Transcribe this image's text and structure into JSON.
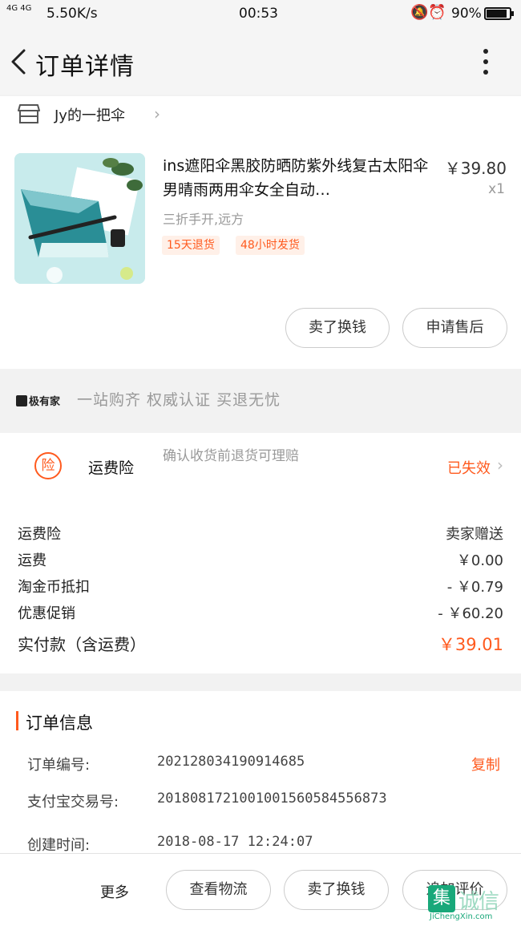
{
  "status_bar": {
    "signal": "4G 4G",
    "speed": "5.50K/s",
    "time": "00:53",
    "battery_percent": "90%",
    "battery_level": 0.9,
    "icons": [
      "mute-bell-icon",
      "alarm-icon"
    ]
  },
  "nav": {
    "title": "订单详情",
    "back_icon": "chevron-left-icon",
    "more_icon": "vertical-dots-icon"
  },
  "store": {
    "name": "Jy的一把伞",
    "icon": "store-icon"
  },
  "product": {
    "title": "ins遮阳伞黑胶防晒防紫外线复古太阳伞男晴雨两用伞女全自动…",
    "price": "￥39.80",
    "quantity": "x1",
    "sku": "三折手开,远方",
    "tags": [
      "15天退货",
      "48小时发货"
    ]
  },
  "product_actions": {
    "sell_label": "卖了换钱",
    "after_sales_label": "申请售后"
  },
  "banner": {
    "logo_text": "极有家",
    "slogan": "一站购齐  权威认证  买退无忧"
  },
  "insurance": {
    "icon_text": "险",
    "name": "运费险",
    "description": "确认收货前退货可理赔",
    "status": "已失效"
  },
  "fees": [
    {
      "label": "运费险",
      "value": "卖家赠送"
    },
    {
      "label": "运费",
      "value": "￥0.00"
    },
    {
      "label": "淘金币抵扣",
      "value": "- ￥0.79"
    },
    {
      "label": "优惠促销",
      "value": "- ￥60.20"
    }
  ],
  "total": {
    "label": "实付款（含运费）",
    "value": "￥39.01"
  },
  "order_info": {
    "title": "订单信息",
    "rows": [
      {
        "key": "订单编号:",
        "value": "202128034190914685"
      },
      {
        "key": "支付宝交易号:",
        "value": "2018081721001001560584556873"
      },
      {
        "key": "创建时间:",
        "value": "2018-08-17 12:24:07"
      }
    ],
    "copy_label": "复制"
  },
  "bottom_bar": {
    "more_label": "更多",
    "logistics_label": "查看物流",
    "sell_label": "卖了换钱",
    "review_label": "追加评价"
  },
  "watermark": {
    "box_text": "集",
    "cn": "诚信",
    "en": "JiChengXin.com"
  },
  "colors": {
    "accent": "#ff5a1e",
    "background": "#f2f2f2"
  }
}
